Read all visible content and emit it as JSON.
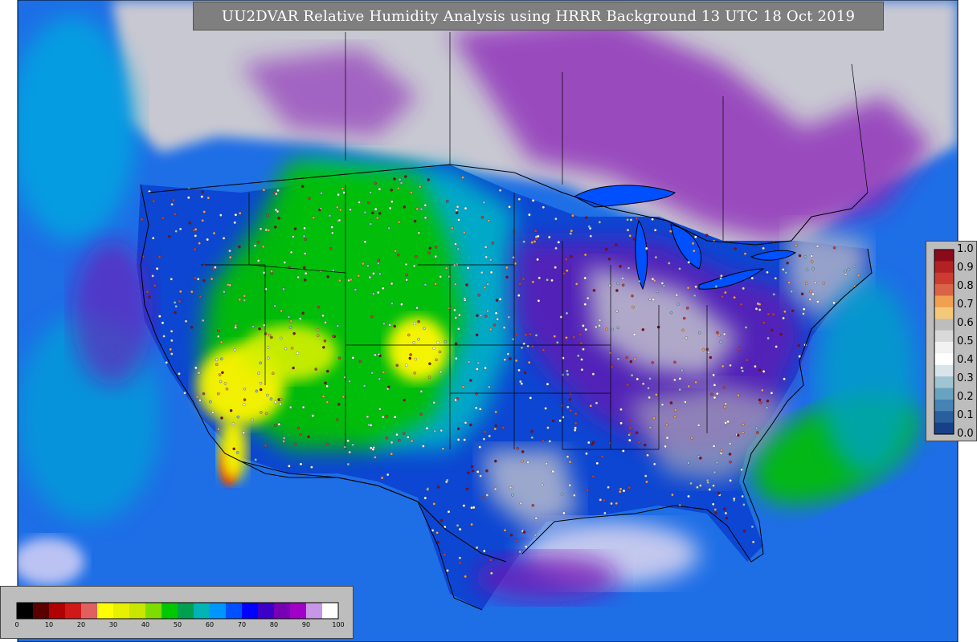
{
  "title": "UU2DVAR Relative Humidity Analysis using HRRR Background 13 UTC 18 Oct 2019",
  "colorbar_bottom": {
    "ticks": [
      "0",
      "10",
      "20",
      "30",
      "40",
      "50",
      "60",
      "70",
      "80",
      "90",
      "100"
    ],
    "colors": [
      "#000000",
      "#5a0000",
      "#b00000",
      "#d01818",
      "#e06060",
      "#ffff00",
      "#e6f000",
      "#c8e600",
      "#7fdc00",
      "#00c800",
      "#00a050",
      "#00b4b4",
      "#0096ff",
      "#0050ff",
      "#0000ff",
      "#3c00c8",
      "#7800b4",
      "#a000c8",
      "#c896e6",
      "#ffffff"
    ]
  },
  "colorbar_right": {
    "ticks": [
      "1.0",
      "0.9",
      "0.8",
      "0.7",
      "0.6",
      "0.5",
      "0.4",
      "0.3",
      "0.2",
      "0.1",
      "0.0"
    ],
    "colors": [
      "#8b0a1a",
      "#b22222",
      "#cd3c32",
      "#dc6446",
      "#f0a050",
      "#f5c878",
      "#bdbdbd",
      "#d9d9d9",
      "#f2f2f2",
      "#ffffff",
      "#d9e4ea",
      "#9fc4d2",
      "#6aa3c0",
      "#4682b4",
      "#2a5f9e",
      "#17408a"
    ]
  },
  "map": {
    "ocean_color": "#1e6ee6",
    "land_bg_color": "#0c46d2",
    "dry_color": "#f0f000",
    "green_color": "#00c000",
    "cyan_color": "#00b4c8",
    "purple_color": "#7a10b0",
    "gray_color": "#cfcfcf",
    "boundary_color": "#000000",
    "station_dot_colors": [
      "#ffffff",
      "#e8e8e8",
      "#d8d8d8",
      "#c04040",
      "#8b0a1a",
      "#90c0d0",
      "#f0a050"
    ]
  }
}
